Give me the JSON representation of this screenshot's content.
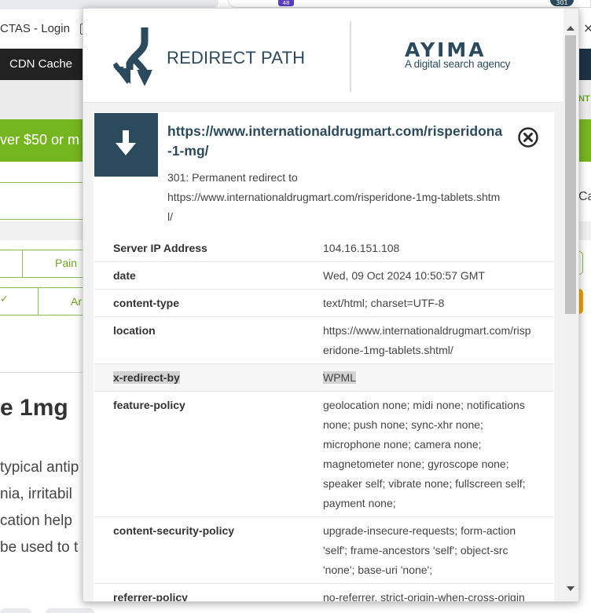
{
  "browser": {
    "ext_badge": "48",
    "ext_301": "301"
  },
  "bookmarks": {
    "item": "CTAS - Login"
  },
  "window": {
    "close": "×"
  },
  "site": {
    "nav_item": "CDN Cache",
    "right_frag": "NT",
    "promo_text": "ver $50 or m",
    "right_frag_ca": "Ca",
    "table_pain": "Pain",
    "table_an": "Ar",
    "table_check": "✓",
    "heading": "e 1mg",
    "paragraph_lines": [
      "typical antip",
      "nia, irritabil",
      "cation help",
      " be used to t"
    ]
  },
  "popup": {
    "brand_name": "REDIRECT PATH",
    "partner_name": "AYIMA",
    "partner_tagline": "A digital search agency",
    "redirect": {
      "url": "https://www.internationaldrugmart.com/risperidona-1-mg/",
      "status_line": "301: Permanent redirect to",
      "target": "https://www.internationaldrugmart.com/risperidone-1mg-tablets.shtml/"
    },
    "headers": [
      {
        "key": "Server IP Address",
        "value": "104.16.151.108"
      },
      {
        "key": "date",
        "value": "Wed, 09 Oct 2024 10:50:57 GMT"
      },
      {
        "key": "content-type",
        "value": "text/html; charset=UTF-8"
      },
      {
        "key": "location",
        "value": "https://www.internationaldrugmart.com/risperidone-1mg-tablets.shtml/"
      },
      {
        "key": "x-redirect-by",
        "value": "WPML"
      },
      {
        "key": "feature-policy",
        "value": "geolocation none; midi none; notifications none; push none; sync-xhr none; microphone none; camera none; magnetometer none; gyroscope none; speaker self; vibrate none; fullscreen self; payment none;"
      },
      {
        "key": "content-security-policy",
        "value": "upgrade-insecure-requests; form-action 'self'; frame-ancestors 'self'; object-src 'none'; base-uri 'none';"
      },
      {
        "key": "referrer-policy",
        "value": "no-referrer, strict-origin-when-cross-origin"
      }
    ]
  },
  "colors": {
    "brand_navy": "#2c4a5e",
    "site_green": "#75b51f",
    "nav_dark": "#222222"
  }
}
